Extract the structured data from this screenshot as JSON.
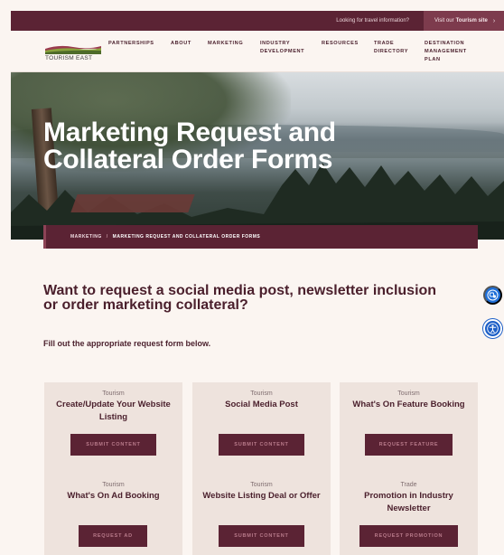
{
  "topbar": {
    "travel_text": "Looking for travel information?",
    "visit_prefix": "Visit our",
    "visit_strong": "Tourism site",
    "visit_chevron": "›"
  },
  "logo": {
    "text": "TOURISM EAST"
  },
  "nav": {
    "items": [
      {
        "label": "PARTNERSHIPS"
      },
      {
        "label": "ABOUT"
      },
      {
        "label": "MARKETING"
      },
      {
        "line1": "INDUSTRY",
        "line2": "DEVELOPMENT"
      },
      {
        "label": "RESOURCES"
      },
      {
        "line1": "TRADE",
        "line2": "DIRECTORY"
      },
      {
        "line1": "DESTINATION",
        "line2": "MANAGEMENT",
        "line3": "PLAN"
      }
    ]
  },
  "hero": {
    "title_line1": "Marketing Request and",
    "title_line2": "Collateral Order Forms"
  },
  "breadcrumb": {
    "parent": "MARKETING",
    "separator": "/",
    "current": "MARKETING REQUEST AND COLLATERAL ORDER FORMS"
  },
  "intro": {
    "headline_line1": "Want to request a social media post, newsletter inclusion",
    "headline_line2": "or order marketing collateral?",
    "subtext": "Fill out the appropriate request form below."
  },
  "cards": [
    {
      "category": "Tourism",
      "title_line1": "Create/Update Your Website",
      "title_line2": "Listing",
      "button": "SUBMIT CONTENT"
    },
    {
      "category": "Tourism",
      "title_line1": "Social Media Post",
      "title_line2": "",
      "button": "SUBMIT CONTENT"
    },
    {
      "category": "Tourism",
      "title_line1": "What's On Feature Booking",
      "title_line2": "",
      "button": "REQUEST FEATURE"
    },
    {
      "category": "Tourism",
      "title_line1": "What's On Ad Booking",
      "title_line2": "",
      "button": "REQUEST AD"
    },
    {
      "category": "Tourism",
      "title_line1": "Website Listing Deal or Offer",
      "title_line2": "",
      "button": "SUBMIT CONTENT"
    },
    {
      "category": "Trade",
      "title_line1": "Promotion in Industry",
      "title_line2": "Newsletter",
      "button": "REQUEST PROMOTION"
    }
  ],
  "colors": {
    "brand": "#5b2334",
    "brand_light": "#7d3b4d",
    "background": "#fbf5f1",
    "card": "#eee3dd",
    "a11y_blue": "#1f6fd8"
  },
  "icons": {
    "accessibility_toolbar": "accessibility-toolbar-icon",
    "accessibility_person": "accessibility-person-icon"
  }
}
